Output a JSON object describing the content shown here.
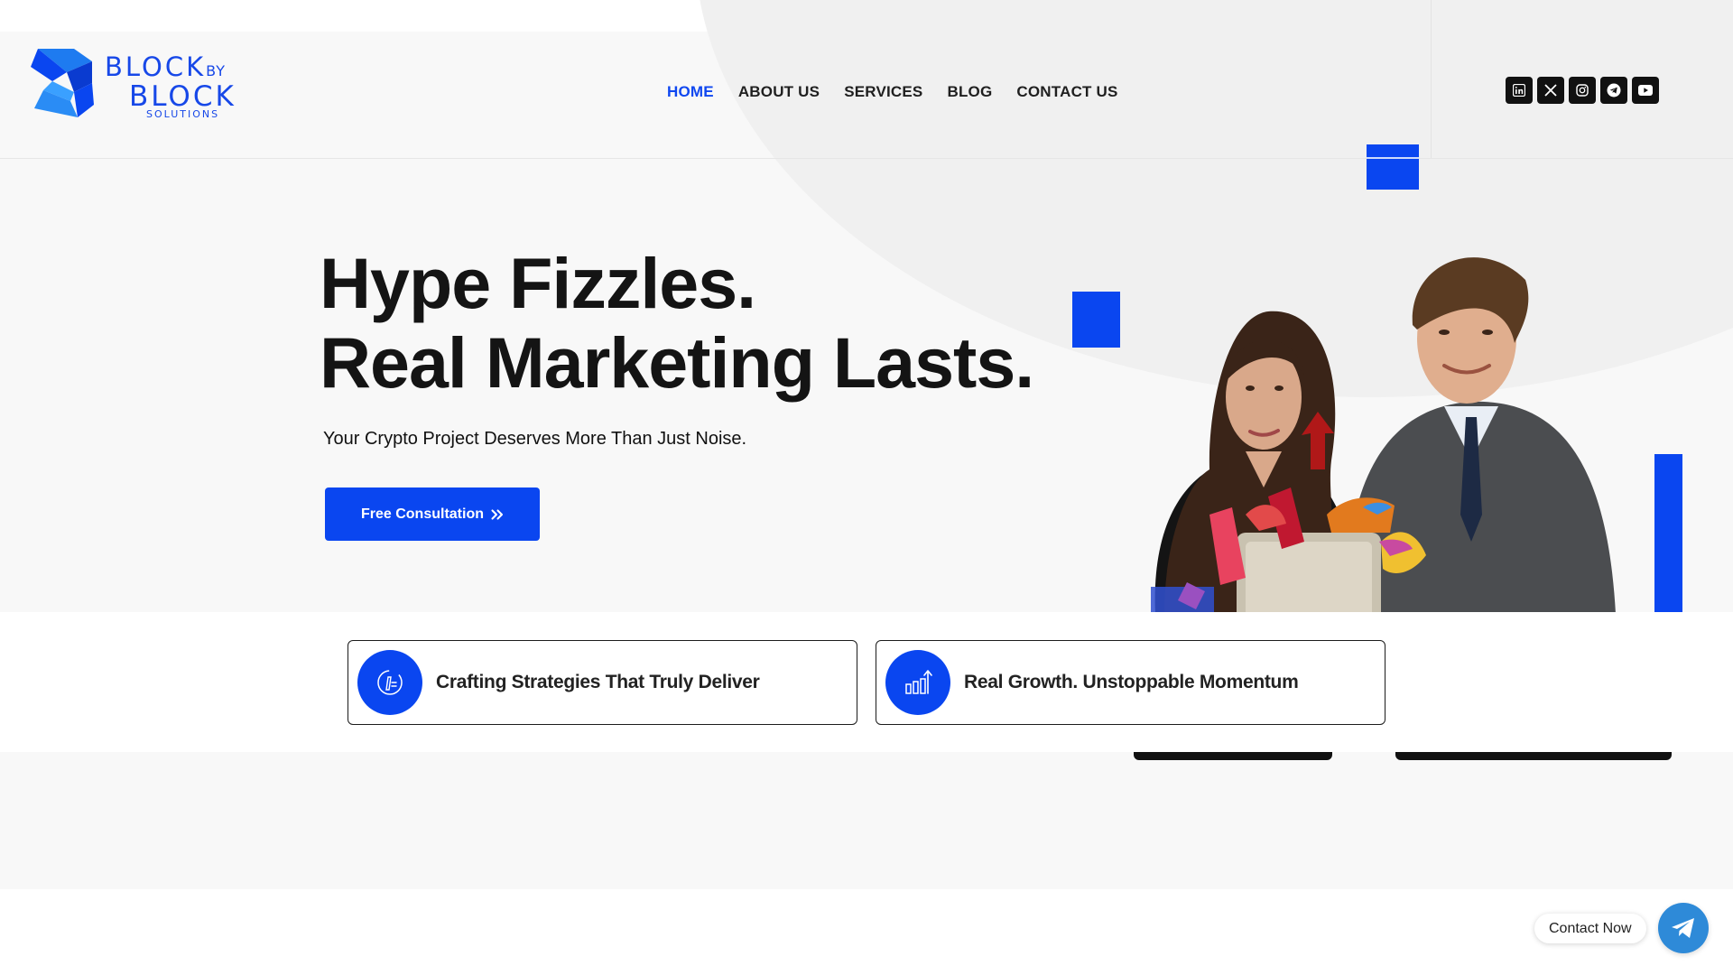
{
  "brand": {
    "line1": "BLOCK",
    "by": "BY",
    "line2": "BLOCK",
    "line3": "SOLUTIONS",
    "accent": "#0a46f0"
  },
  "nav": {
    "items": [
      {
        "label": "HOME",
        "active": true
      },
      {
        "label": "ABOUT US",
        "active": false
      },
      {
        "label": "SERVICES",
        "active": false
      },
      {
        "label": "BLOG",
        "active": false
      },
      {
        "label": "CONTACT US",
        "active": false
      }
    ]
  },
  "social": {
    "icons": [
      "linkedin-icon",
      "x-icon",
      "instagram-icon",
      "telegram-icon",
      "youtube-icon"
    ]
  },
  "hero": {
    "title_line1": "Hype Fizzles.",
    "title_line2": "Real Marketing Lasts.",
    "subtitle": "Your Crypto Project Deserves More Than Just Noise.",
    "cta_label": "Free Consultation"
  },
  "features": [
    {
      "icon": "strategy-icon",
      "label": "Crafting Strategies That Truly Deliver"
    },
    {
      "icon": "growth-chart-icon",
      "label": "Real Growth. Unstoppable Momentum"
    }
  ],
  "contact_widget": {
    "label": "Contact Now",
    "icon": "telegram-icon",
    "color": "#2e8ad8"
  }
}
